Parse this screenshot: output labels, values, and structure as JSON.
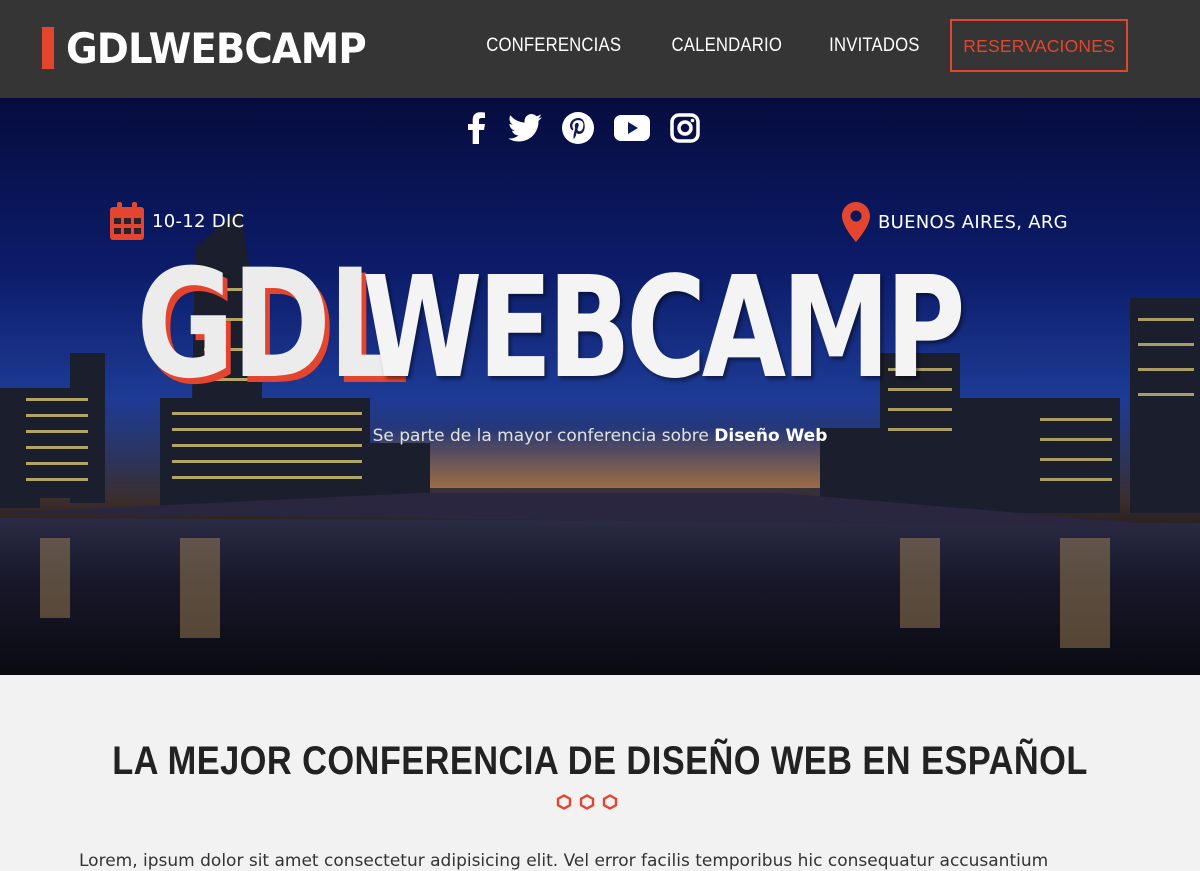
{
  "header": {
    "logo": "GDLWEBCAMP",
    "nav": [
      {
        "label": "CONFERENCIAS"
      },
      {
        "label": "CALENDARIO"
      },
      {
        "label": "INVITADOS"
      },
      {
        "label": "RESERVACIONES"
      }
    ]
  },
  "hero": {
    "social": [
      "facebook-icon",
      "twitter-icon",
      "pinterest-icon",
      "youtube-icon",
      "instagram-icon"
    ],
    "date": "10-12 DIC",
    "location": "BUENOS AIRES, ARG",
    "title_part1": "GDL",
    "title_part2": "WEBCAMP",
    "tagline_prefix": "Se parte de la mayor conferencia sobre ",
    "tagline_emphasis": "Diseño Web"
  },
  "content": {
    "title": "LA MEJOR CONFERENCIA DE DISEÑO WEB EN ESPAÑOL",
    "body_text": "Lorem, ipsum dolor sit amet consectetur adipisicing elit. Vel error facilis temporibus hic consequatur accusantium"
  },
  "colors": {
    "accent": "#e4452f",
    "header_bg": "#353535",
    "content_bg": "#f2f2f2"
  }
}
